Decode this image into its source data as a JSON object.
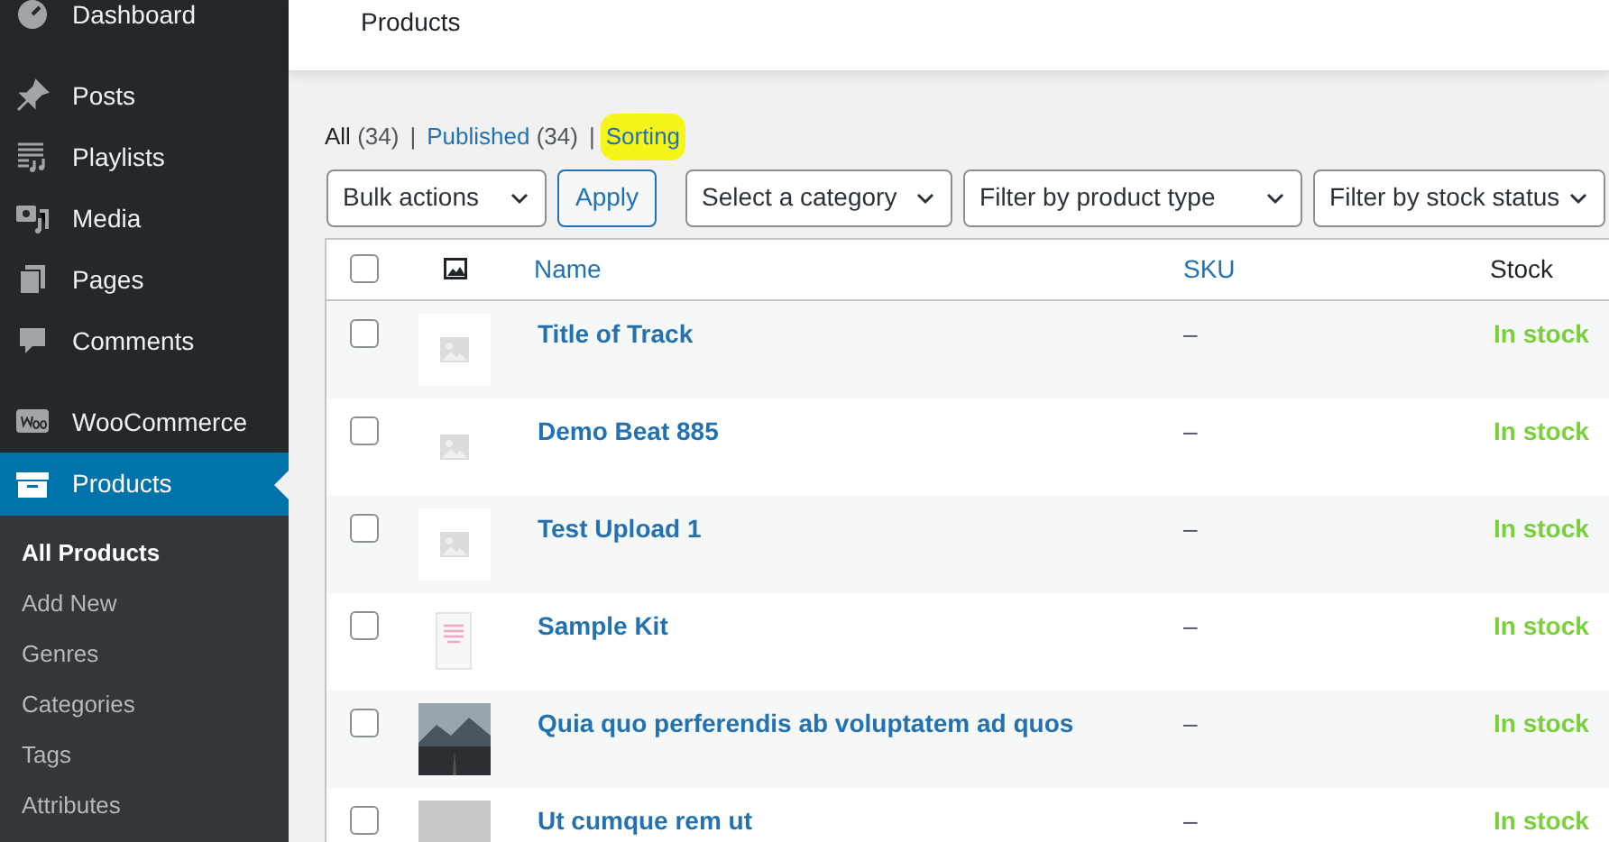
{
  "sidebar": {
    "items": [
      {
        "label": "Dashboard",
        "kind": "dashboard",
        "selected": false
      },
      {
        "label": "Posts",
        "kind": "pin",
        "selected": false
      },
      {
        "label": "Playlists",
        "kind": "playlist",
        "selected": false
      },
      {
        "label": "Media",
        "kind": "media",
        "selected": false
      },
      {
        "label": "Pages",
        "kind": "pages",
        "selected": false
      },
      {
        "label": "Comments",
        "kind": "comment",
        "selected": false
      },
      {
        "label": "WooCommerce",
        "kind": "woo",
        "selected": false
      },
      {
        "label": "Products",
        "kind": "archive",
        "selected": true
      }
    ],
    "submenu": [
      {
        "label": "All Products",
        "selected": true
      },
      {
        "label": "Add New",
        "selected": false
      },
      {
        "label": "Genres",
        "selected": false
      },
      {
        "label": "Categories",
        "selected": false
      },
      {
        "label": "Tags",
        "selected": false
      },
      {
        "label": "Attributes",
        "selected": false
      }
    ]
  },
  "header": {
    "title": "Products"
  },
  "views": [
    {
      "label": "All",
      "count": "(34)",
      "selected": true,
      "highlighted": false
    },
    {
      "separator": "|",
      "label": "Published",
      "count": "(34)",
      "selected": false,
      "highlighted": false
    },
    {
      "separator": "|",
      "label": "Sorting",
      "selected": false,
      "highlighted": true
    }
  ],
  "filters": {
    "bulk": "Bulk actions",
    "apply": "Apply",
    "category": "Select a category",
    "type": "Filter by product type",
    "stock": "Filter by stock status"
  },
  "table": {
    "all_checked": false,
    "columns": [
      "Name",
      "SKU",
      "Stock"
    ],
    "rows": [
      {
        "kind": "placeholder",
        "name": "Title of Track",
        "sku": "–",
        "stock": "In stock",
        "checked": false
      },
      {
        "kind": "plain",
        "name": "Demo Beat 885",
        "sku": "–",
        "stock": "In stock",
        "checked": false
      },
      {
        "kind": "placeholder",
        "name": "Test Upload 1",
        "sku": "–",
        "stock": "In stock",
        "checked": false
      },
      {
        "kind": "box",
        "name": "Sample Kit",
        "sku": "–",
        "stock": "In stock",
        "checked": false
      },
      {
        "kind": "photo",
        "name": "Quia quo perferendis ab voluptatem ad quos",
        "sku": "–",
        "stock": "In stock",
        "checked": false
      },
      {
        "kind": "grey",
        "name": "Ut cumque rem ut",
        "sku": "–",
        "stock": "In stock",
        "checked": false
      }
    ]
  }
}
